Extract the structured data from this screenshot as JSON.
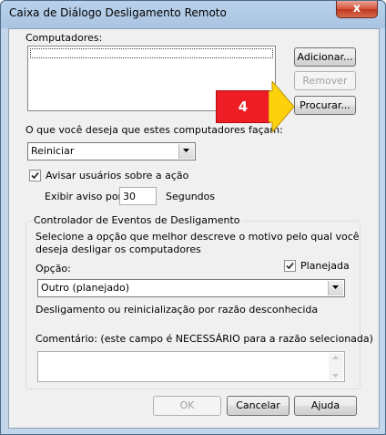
{
  "window": {
    "title": "Caixa de Diálogo Desligamento Remoto",
    "close_label": "x"
  },
  "computers": {
    "label": "Computadores:"
  },
  "buttons": {
    "add": "Adicionar...",
    "remove": "Remover",
    "browse": "Procurar...",
    "ok": "OK",
    "cancel": "Cancelar",
    "help": "Ajuda"
  },
  "action": {
    "label": "O que você deseja que estes computadores façam:",
    "selected": "Reiniciar"
  },
  "warn": {
    "checkbox_label": "Avisar usuários sobre a ação",
    "checked": true,
    "display_label": "Exibir aviso por",
    "seconds_value": "30",
    "seconds_unit": "Segundos"
  },
  "tracker": {
    "title": "Controlador de Eventos de Desligamento",
    "description_line1": "Selecione a opção que melhor descreve o motivo pelo qual você",
    "description_line2": "deseja desligar os computadores",
    "option_label": "Opção:",
    "planned_label": "Planejada",
    "planned_checked": true,
    "option_selected": "Outro (planejado)",
    "option_description": "Desligamento ou reinicialização por razão desconhecida",
    "comment_label": "Comentário: (este campo é NECESSÁRIO para a razão selecionada)"
  },
  "callout": {
    "number": "4",
    "color": "#ee1c24",
    "arrow_color": "#fdd10b"
  }
}
